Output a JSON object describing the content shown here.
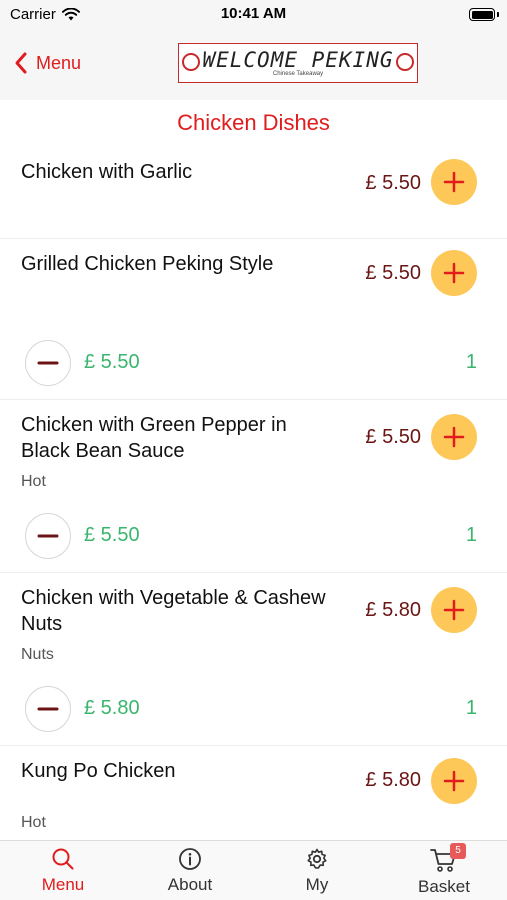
{
  "status_bar": {
    "carrier": "Carrier",
    "time": "10:41 AM"
  },
  "nav": {
    "back_label": "Menu",
    "logo_title": "WELCOME PEKING",
    "logo_subtitle": "Chinese Takeaway"
  },
  "section_title": "Chicken Dishes",
  "dishes": [
    {
      "name": "Chicken with Garlic",
      "price": "£ 5.50"
    },
    {
      "name": "Grilled Chicken Peking Style",
      "price": "£ 5.50",
      "line_price": "£ 5.50",
      "quantity": "1"
    },
    {
      "name": "Chicken with Green Pepper in Black Bean Sauce",
      "price": "£ 5.50",
      "note": "Hot",
      "line_price": "£ 5.50",
      "quantity": "1"
    },
    {
      "name": "Chicken with Vegetable & Cashew Nuts",
      "price": "£ 5.80",
      "note": "Nuts",
      "line_price": "£ 5.80",
      "quantity": "1"
    },
    {
      "name": "Kung Po Chicken",
      "price": "£ 5.80",
      "note": "Hot"
    }
  ],
  "tabs": [
    {
      "label": "Menu",
      "icon": "search-icon",
      "active": true
    },
    {
      "label": "About",
      "icon": "info-icon",
      "active": false
    },
    {
      "label": "My",
      "icon": "gear-icon",
      "active": false
    },
    {
      "label": "Basket",
      "icon": "cart-icon",
      "active": false,
      "badge": "5"
    }
  ],
  "colors": {
    "accent_red": "#e01c1c",
    "price_dark_red": "#6b1414",
    "add_button_yellow": "#fdc858",
    "line_price_green": "#3bb56e",
    "badge_red": "#e85a5a"
  }
}
